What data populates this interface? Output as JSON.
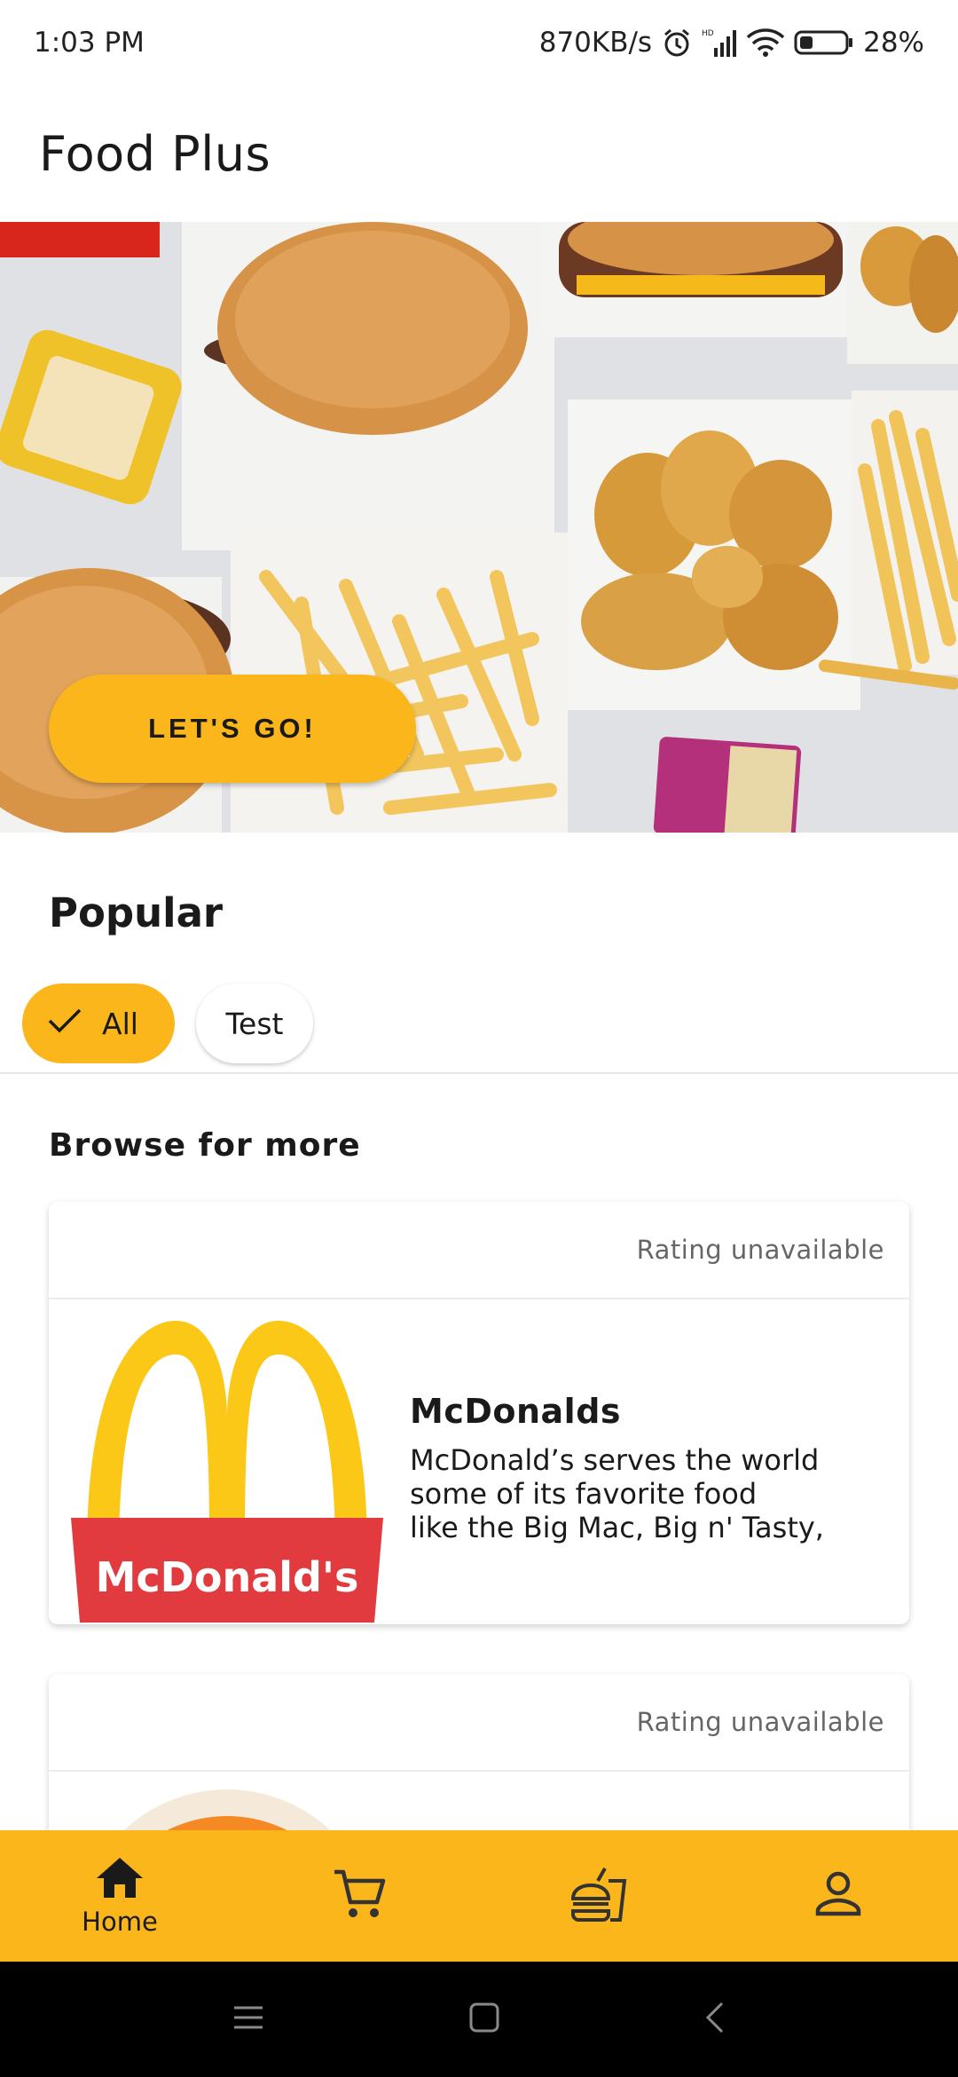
{
  "status_bar": {
    "time": "1:03 PM",
    "network_speed": "870KB/s",
    "battery": "28%",
    "icons": [
      "alarm-icon",
      "hd-signal-icon",
      "wifi-icon",
      "battery-icon"
    ]
  },
  "app_bar": {
    "title": "Food Plus"
  },
  "hero": {
    "image": "food-spread-burgers-fries-nuggets",
    "cta_label": "LET'S GO!"
  },
  "popular": {
    "title": "Popular",
    "chips": [
      {
        "label": "All",
        "selected": true,
        "icon": "check-icon"
      },
      {
        "label": "Test",
        "selected": false
      }
    ]
  },
  "browse": {
    "title": "Browse for more",
    "restaurants": [
      {
        "rating": "Rating unavailable",
        "name": "McDonalds",
        "description": "McDonald’s serves the world\nsome of its favorite food\nlike the Big Mac, Big n' Tasty, Qu…",
        "logo": "mcdonalds-logo",
        "logo_text": "McDonald's"
      },
      {
        "rating": "Rating unavailable",
        "logo": "orange-round-logo"
      }
    ]
  },
  "bottom_nav": {
    "items": [
      {
        "label": "Home",
        "icon": "home-icon",
        "active": true
      },
      {
        "label": "",
        "icon": "cart-icon"
      },
      {
        "label": "",
        "icon": "fast-food-icon"
      },
      {
        "label": "",
        "icon": "profile-icon"
      }
    ]
  },
  "system_nav": {
    "icons": [
      "menu-icon",
      "home-square-icon",
      "back-icon"
    ]
  },
  "colors": {
    "accent": "#fbb61b",
    "mcd_red": "#e23b3f",
    "mcd_yellow": "#fbc817"
  }
}
